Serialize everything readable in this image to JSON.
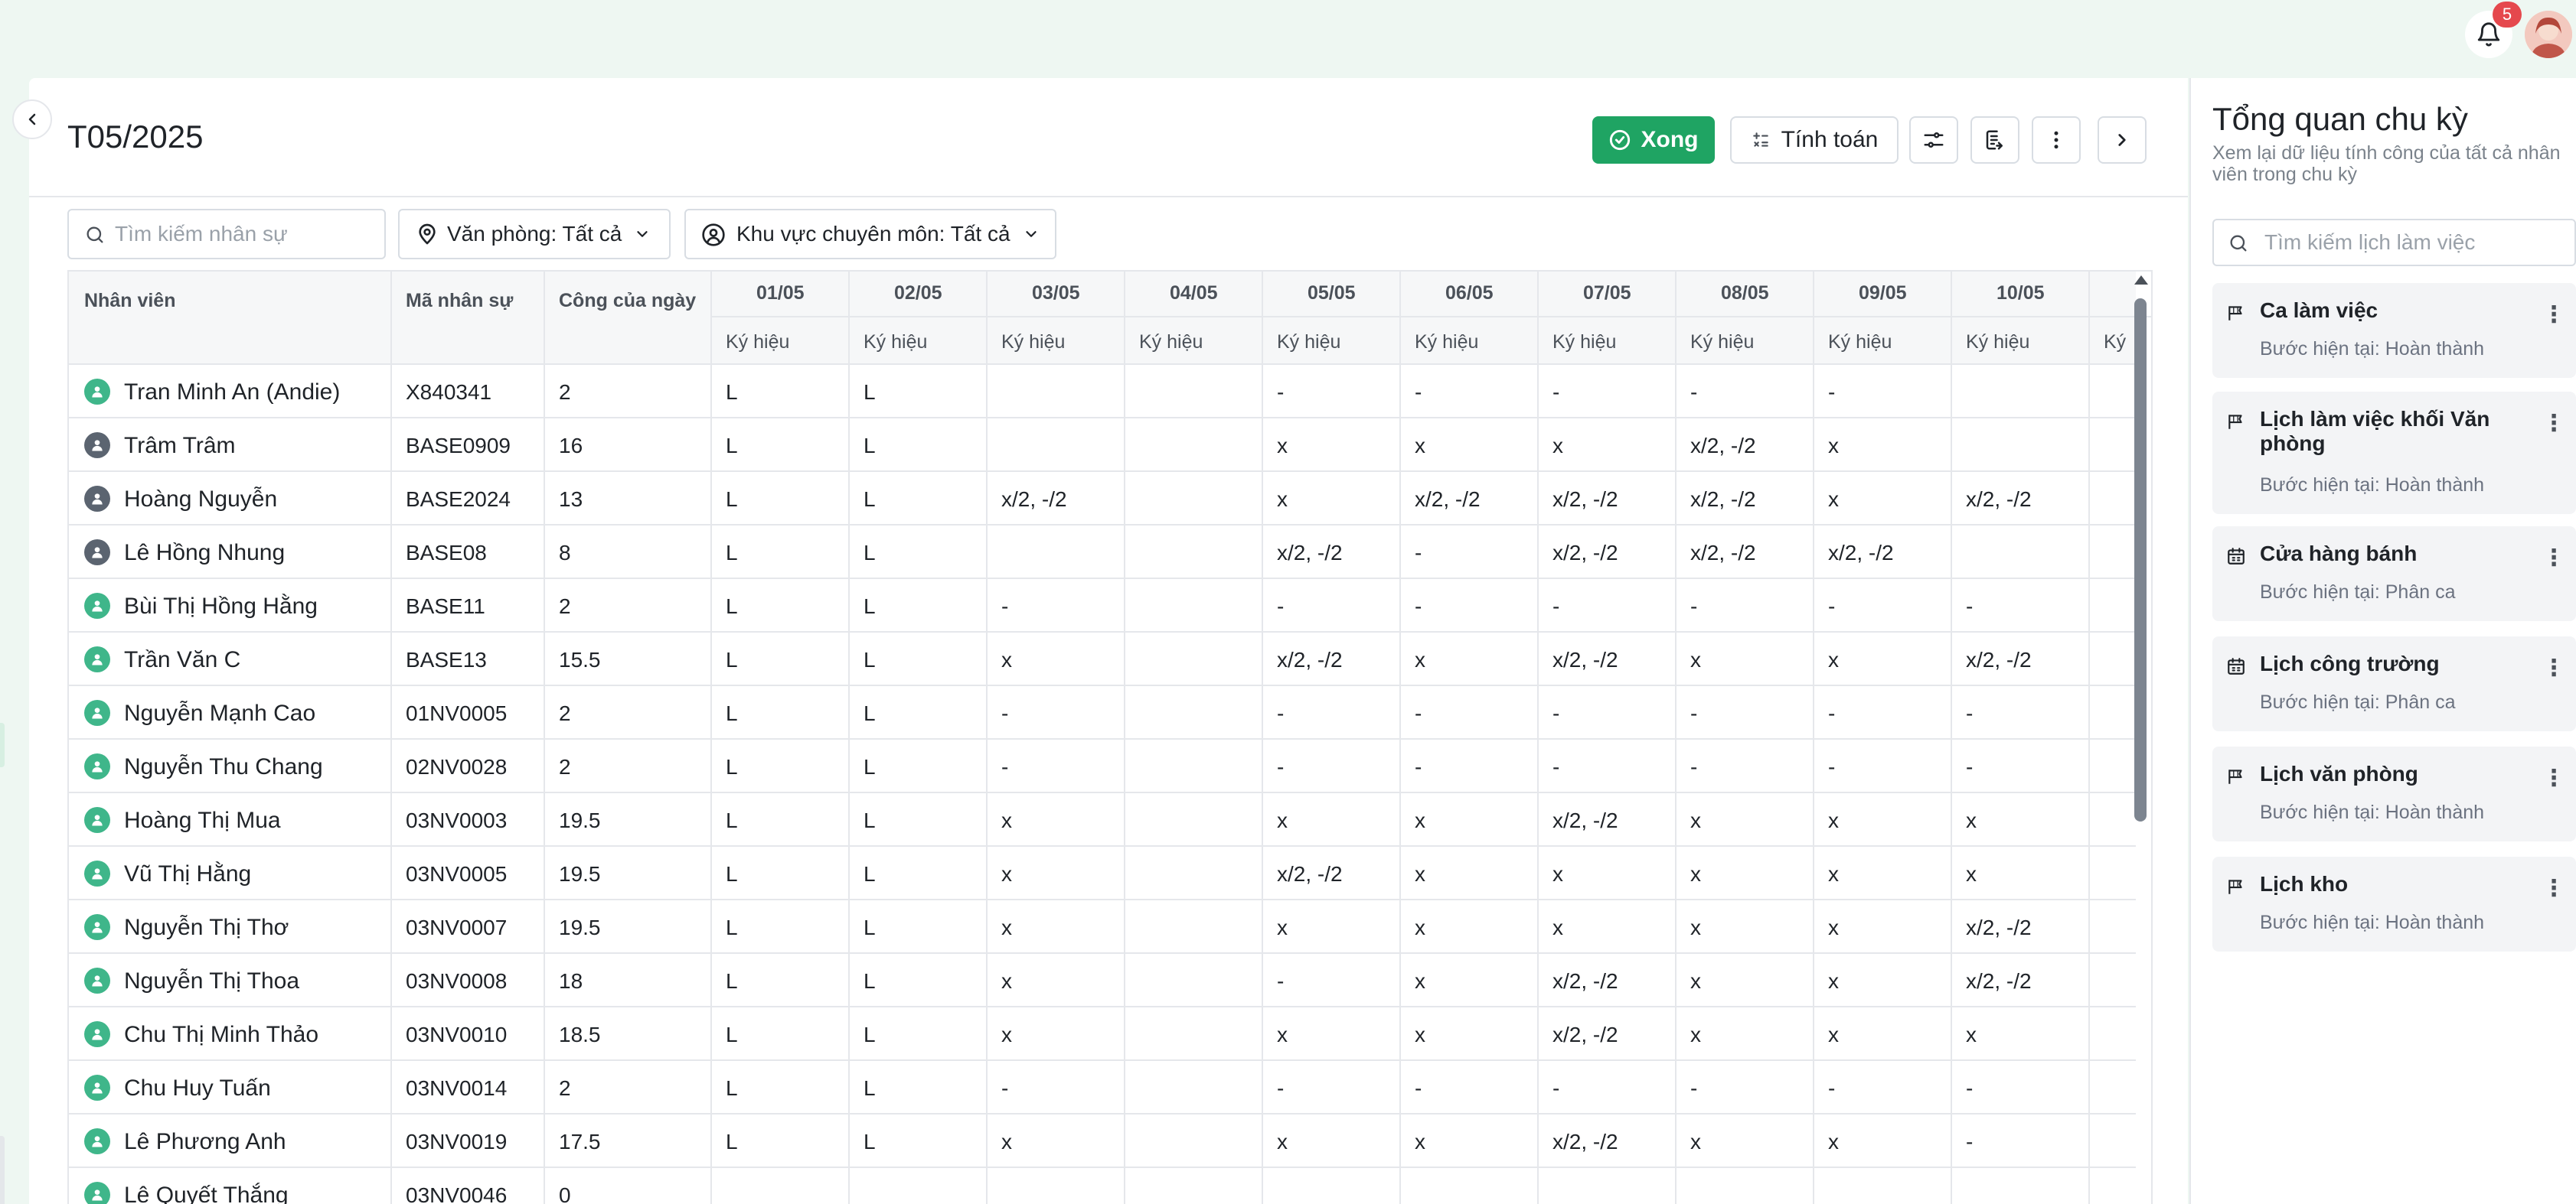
{
  "topbar": {
    "notification_count": "5"
  },
  "header": {
    "title": "T05/2025",
    "done_label": "Xong",
    "calc_label": "Tính toán"
  },
  "filters": {
    "search_placeholder": "Tìm kiếm nhân sự",
    "office_label": "Văn phòng: Tất cả",
    "area_label": "Khu vực chuyên môn: Tất cả"
  },
  "table": {
    "headers": {
      "employee": "Nhân viên",
      "code": "Mã nhân sự",
      "workdays": "Công của ngày"
    },
    "dates": [
      "01/05",
      "02/05",
      "03/05",
      "04/05",
      "05/05",
      "06/05",
      "07/05",
      "08/05",
      "09/05",
      "10/05"
    ],
    "sub_header": "Ký hiệu",
    "sub_header_partial": "Ký",
    "rows": [
      {
        "name": "Tran Minh An (Andie)",
        "code": "X840341",
        "work": "2",
        "avatar": "default",
        "cells": [
          "L",
          "L",
          "",
          "",
          "-",
          "-",
          "-",
          "-",
          "-",
          ""
        ]
      },
      {
        "name": "Trâm Trâm",
        "code": "BASE0909",
        "work": "16",
        "avatar": "photo",
        "cells": [
          "L",
          "L",
          "",
          "",
          "x",
          "x",
          "x",
          "x/2, -/2",
          "x",
          ""
        ]
      },
      {
        "name": "Hoàng Nguyễn",
        "code": "BASE2024",
        "work": "13",
        "avatar": "photo",
        "cells": [
          "L",
          "L",
          "x/2, -/2",
          "",
          "x",
          "x/2, -/2",
          "x/2, -/2",
          "x/2, -/2",
          "x",
          "x/2, -/2"
        ]
      },
      {
        "name": "Lê Hồng Nhung",
        "code": "BASE08",
        "work": "8",
        "avatar": "photo",
        "cells": [
          "L",
          "L",
          "",
          "",
          "x/2, -/2",
          "-",
          "x/2, -/2",
          "x/2, -/2",
          "x/2, -/2",
          ""
        ]
      },
      {
        "name": "Bùi Thị Hồng Hằng",
        "code": "BASE11",
        "work": "2",
        "avatar": "default",
        "cells": [
          "L",
          "L",
          "-",
          "",
          "-",
          "-",
          "-",
          "-",
          "-",
          "-"
        ]
      },
      {
        "name": "Trần Văn C",
        "code": "BASE13",
        "work": "15.5",
        "avatar": "default",
        "cells": [
          "L",
          "L",
          "x",
          "",
          "x/2, -/2",
          "x",
          "x/2, -/2",
          "x",
          "x",
          "x/2, -/2"
        ]
      },
      {
        "name": "Nguyễn Mạnh Cao",
        "code": "01NV0005",
        "work": "2",
        "avatar": "default",
        "cells": [
          "L",
          "L",
          "-",
          "",
          "-",
          "-",
          "-",
          "-",
          "-",
          "-"
        ]
      },
      {
        "name": "Nguyễn Thu Chang",
        "code": "02NV0028",
        "work": "2",
        "avatar": "default",
        "cells": [
          "L",
          "L",
          "-",
          "",
          "-",
          "-",
          "-",
          "-",
          "-",
          "-"
        ]
      },
      {
        "name": "Hoàng Thị Mua",
        "code": "03NV0003",
        "work": "19.5",
        "avatar": "default",
        "cells": [
          "L",
          "L",
          "x",
          "",
          "x",
          "x",
          "x/2, -/2",
          "x",
          "x",
          "x"
        ]
      },
      {
        "name": "Vũ Thị Hằng",
        "code": "03NV0005",
        "work": "19.5",
        "avatar": "default",
        "cells": [
          "L",
          "L",
          "x",
          "",
          "x/2, -/2",
          "x",
          "x",
          "x",
          "x",
          "x"
        ]
      },
      {
        "name": "Nguyễn Thị Thơ",
        "code": "03NV0007",
        "work": "19.5",
        "avatar": "default",
        "cells": [
          "L",
          "L",
          "x",
          "",
          "x",
          "x",
          "x",
          "x",
          "x",
          "x/2, -/2"
        ]
      },
      {
        "name": "Nguyễn Thị Thoa",
        "code": "03NV0008",
        "work": "18",
        "avatar": "default",
        "cells": [
          "L",
          "L",
          "x",
          "",
          "-",
          "x",
          "x/2, -/2",
          "x",
          "x",
          "x/2, -/2"
        ]
      },
      {
        "name": "Chu Thị Minh Thảo",
        "code": "03NV0010",
        "work": "18.5",
        "avatar": "default",
        "cells": [
          "L",
          "L",
          "x",
          "",
          "x",
          "x",
          "x/2, -/2",
          "x",
          "x",
          "x"
        ]
      },
      {
        "name": "Chu Huy Tuấn",
        "code": "03NV0014",
        "work": "2",
        "avatar": "default",
        "cells": [
          "L",
          "L",
          "-",
          "",
          "-",
          "-",
          "-",
          "-",
          "-",
          "-"
        ]
      },
      {
        "name": "Lê Phương Anh",
        "code": "03NV0019",
        "work": "17.5",
        "avatar": "default",
        "cells": [
          "L",
          "L",
          "x",
          "",
          "x",
          "x",
          "x/2, -/2",
          "x",
          "x",
          "-"
        ]
      },
      {
        "name": "Lê Quyết Thắng",
        "code": "03NV0046",
        "work": "0",
        "avatar": "default",
        "cells": [
          "",
          "",
          "",
          "",
          "",
          "",
          "",
          "",
          "",
          ""
        ]
      }
    ]
  },
  "overview": {
    "title": "Tổng quan chu kỳ",
    "subtitle": "Xem lại dữ liệu tính công của tất cả nhân viên trong chu kỳ",
    "search_placeholder": "Tìm kiếm lịch làm việc",
    "cards": [
      {
        "title": "Ca làm việc",
        "step": "Bước hiện tại: Hoàn thành",
        "icon": "flag-icon"
      },
      {
        "title": "Lịch làm việc khối Văn phòng",
        "step": "Bước hiện tại: Hoàn thành",
        "icon": "flag-icon"
      },
      {
        "title": "Cửa hàng bánh",
        "step": "Bước hiện tại: Phân ca",
        "icon": "calendar-icon"
      },
      {
        "title": "Lịch công trường",
        "step": "Bước hiện tại: Phân ca",
        "icon": "calendar-icon"
      },
      {
        "title": "Lịch văn phòng",
        "step": "Bước hiện tại: Hoàn thành",
        "icon": "flag-icon"
      },
      {
        "title": "Lịch kho",
        "step": "Bước hiện tại: Hoàn thành",
        "icon": "flag-icon"
      }
    ]
  },
  "colors": {
    "accent": "#1fa463",
    "badge": "#e5484d",
    "avatar": "#3fb68a"
  }
}
